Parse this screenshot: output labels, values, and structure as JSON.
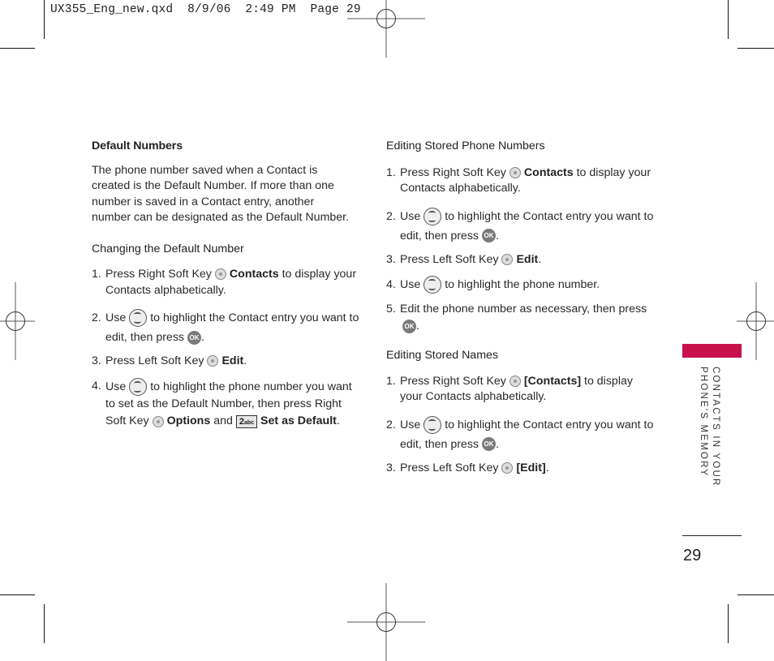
{
  "slug": "UX355_Eng_new.qxd  8/9/06  2:49 PM  Page 29",
  "accent_color": "#c8104a",
  "left_column": {
    "section_title": "Default Numbers",
    "intro": "The phone number saved when a Contact is created is the Default Number. If more than one number is saved in a Contact entry, another number can be designated as the Default Number.",
    "subsection_title": "Changing the Default Number",
    "steps": [
      {
        "num": "1.",
        "pre": "Press Right Soft Key",
        "icon": "right-soft-key-icon",
        "bold": "Contacts",
        "post": "to display your Contacts alphabetically."
      },
      {
        "num": "2.",
        "pre": "Use",
        "icon": "navigation-key-icon",
        "post": "to highlight the Contact entry you want to edit, then press",
        "icon2": "ok-key-icon",
        "end": "."
      },
      {
        "num": "3.",
        "pre": "Press Left Soft Key",
        "icon": "left-soft-key-icon",
        "bold": "Edit",
        "end": "."
      },
      {
        "num": "4.",
        "pre": "Use",
        "icon": "navigation-key-icon",
        "post": "to highlight the phone number you want to set as the Default Number, then press  Right Soft Key",
        "icon2": "right-soft-key-icon",
        "bold": "Options",
        "mid": "and",
        "icon3": "key-2-abc-icon",
        "key_label": "2",
        "key_sub": "abc",
        "bold2": "Set as Default",
        "end": "."
      }
    ]
  },
  "right_column": {
    "section1_title": "Editing Stored Phone Numbers",
    "section1_steps": [
      {
        "num": "1.",
        "pre": "Press Right Soft Key",
        "bold": "Contacts",
        "post": "to display your Contacts alphabetically."
      },
      {
        "num": "2.",
        "pre": "Use",
        "post": "to highlight the Contact entry you want to edit, then press",
        "end": "."
      },
      {
        "num": "3.",
        "pre": "Press Left Soft Key",
        "bold": "Edit",
        "end": "."
      },
      {
        "num": "4.",
        "pre": "Use",
        "post": "to highlight the phone number."
      },
      {
        "num": "5.",
        "pre": "Edit the phone number as necessary, then press",
        "end": "."
      }
    ],
    "section2_title": "Editing Stored Names",
    "section2_steps": [
      {
        "num": "1.",
        "pre": "Press Right Soft Key",
        "bold": "[Contacts]",
        "post": "to display your Contacts alphabetically."
      },
      {
        "num": "2.",
        "pre": "Use",
        "post": "to highlight the Contact entry you want to edit, then press",
        "end": "."
      },
      {
        "num": "3.",
        "pre": "Press Left Soft Key",
        "bold": "[Edit]",
        "end": "."
      }
    ]
  },
  "side_tab": {
    "line1": "CONTACTS IN YOUR",
    "line2": "PHONE'S MEMORY"
  },
  "ok_label": "OK",
  "page_number": "29"
}
